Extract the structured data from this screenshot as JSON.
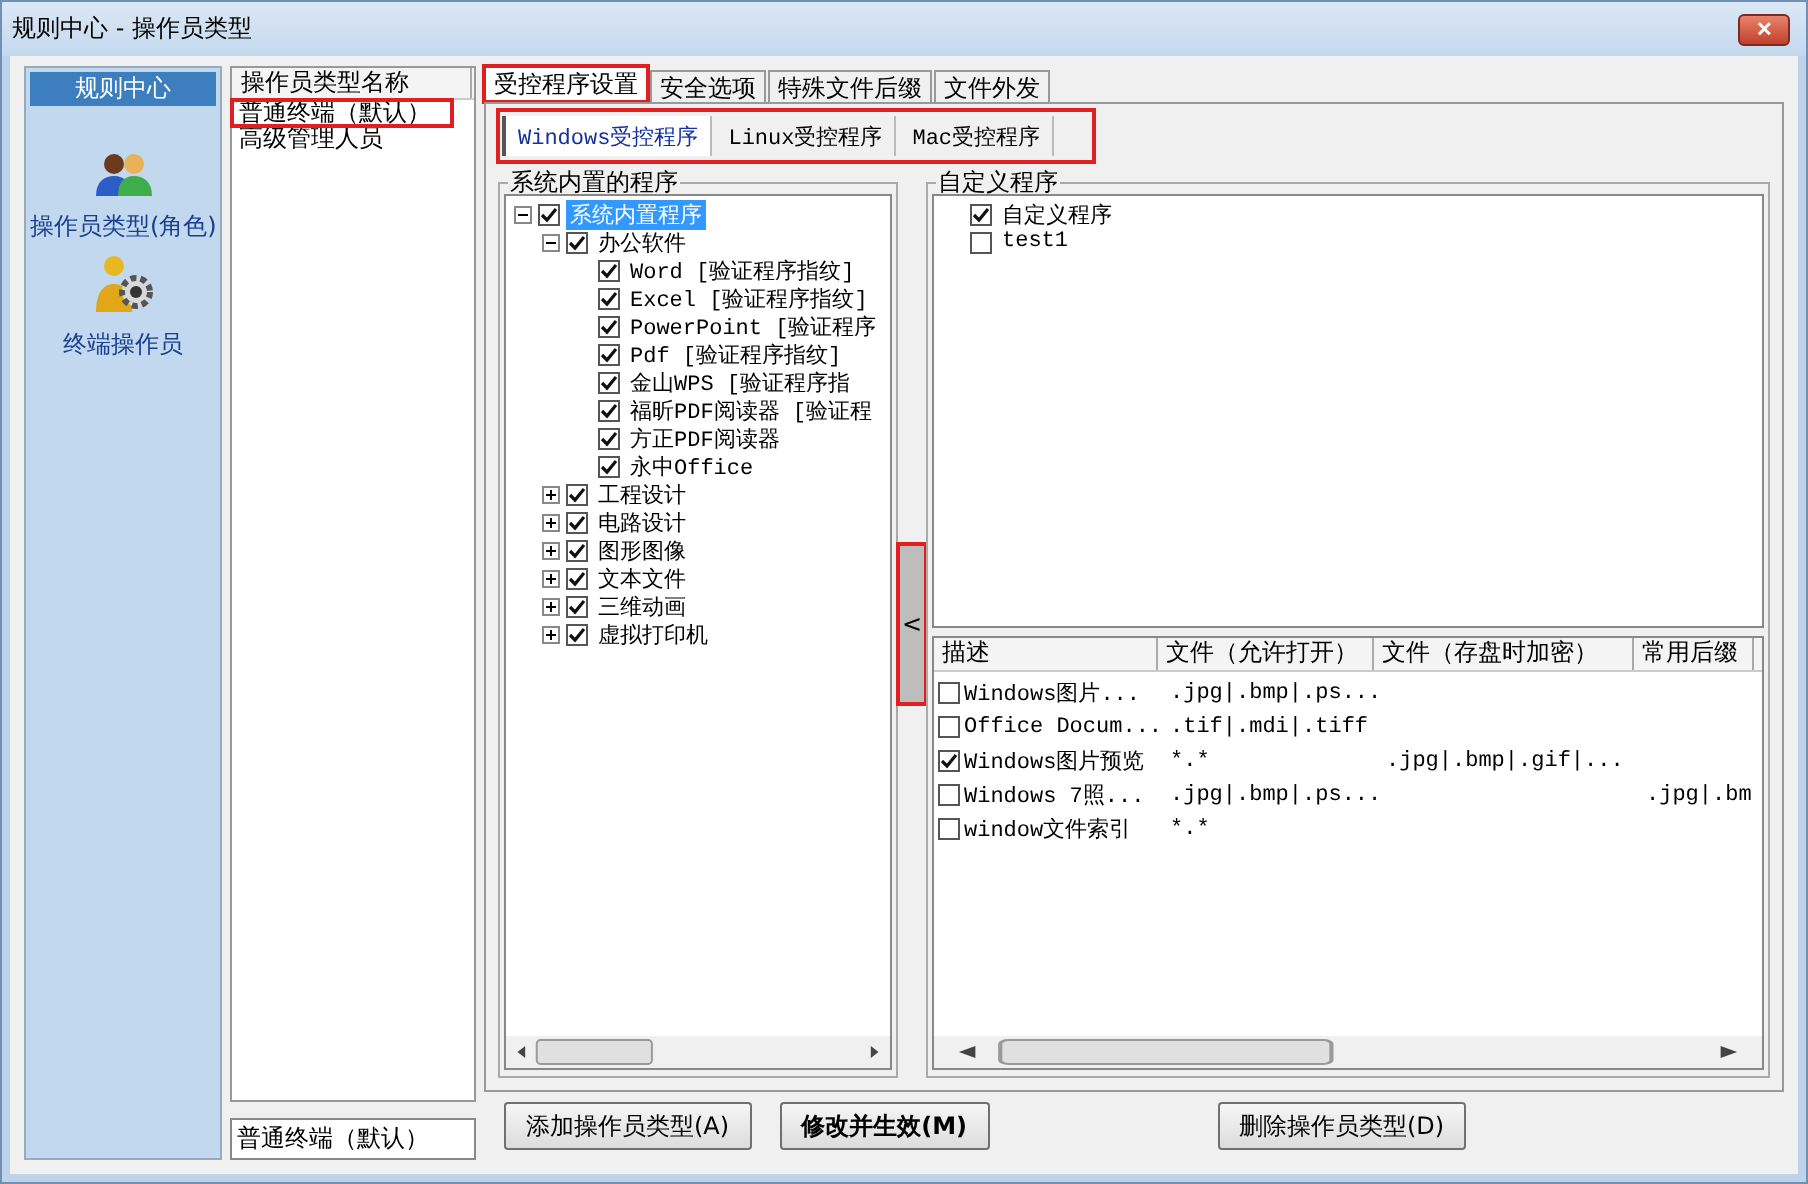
{
  "window": {
    "title": "规则中心 - 操作员类型",
    "close_glyph": "✕"
  },
  "sidebar": {
    "title": "规则中心",
    "items": [
      {
        "label": "操作员类型(角色)",
        "kind": "role"
      },
      {
        "label": "终端操作员",
        "kind": "terminal"
      }
    ]
  },
  "operator_types": {
    "columns": [
      "操作员类型名称"
    ],
    "rows": [
      {
        "label": "普通终端（默认）",
        "selected": false,
        "highlighted": true
      },
      {
        "label": "高级管理人员",
        "selected": false,
        "highlighted": false
      }
    ],
    "name_field": {
      "value": "普通终端（默认）"
    }
  },
  "tabs": [
    {
      "label": "受控程序设置",
      "selected": true,
      "highlighted": true
    },
    {
      "label": "安全选项",
      "selected": false,
      "highlighted": false
    },
    {
      "label": "特殊文件后缀",
      "selected": false,
      "highlighted": false
    },
    {
      "label": "文件外发",
      "selected": false,
      "highlighted": false
    }
  ],
  "subtab_bar": {
    "highlighted": true,
    "tabs": [
      {
        "label": "Windows受控程序",
        "selected": true
      },
      {
        "label": "Linux受控程序",
        "selected": false
      },
      {
        "label": "Mac受控程序",
        "selected": false
      }
    ]
  },
  "builtin_programs": {
    "title": "系统内置的程序",
    "tree": [
      {
        "label": "系统内置程序",
        "checked": true,
        "selected": true,
        "expanded": true,
        "children": [
          {
            "label": "办公软件",
            "checked": true,
            "selected": false,
            "expanded": true,
            "children": [
              {
                "label": "Word [验证程序指纹]",
                "checked": true,
                "selected": false
              },
              {
                "label": "Excel [验证程序指纹]",
                "checked": true,
                "selected": false
              },
              {
                "label": "PowerPoint [验证程序",
                "checked": true,
                "selected": false
              },
              {
                "label": "Pdf [验证程序指纹]",
                "checked": true,
                "selected": false
              },
              {
                "label": "金山WPS [验证程序指",
                "checked": true,
                "selected": false
              },
              {
                "label": "福昕PDF阅读器 [验证程",
                "checked": true,
                "selected": false
              },
              {
                "label": "方正PDF阅读器",
                "checked": true,
                "selected": false
              },
              {
                "label": "永中Office",
                "checked": true,
                "selected": false
              }
            ]
          },
          {
            "label": "工程设计",
            "checked": true,
            "selected": false,
            "expanded": false
          },
          {
            "label": "电路设计",
            "checked": true,
            "selected": false,
            "expanded": false
          },
          {
            "label": "图形图像",
            "checked": true,
            "selected": false,
            "expanded": false
          },
          {
            "label": "文本文件",
            "checked": true,
            "selected": false,
            "expanded": false
          },
          {
            "label": "三维动画",
            "checked": true,
            "selected": false,
            "expanded": false
          },
          {
            "label": "虚拟打印机",
            "checked": true,
            "selected": false,
            "expanded": false
          }
        ]
      }
    ]
  },
  "splitter": {
    "glyph": "<",
    "highlighted": true
  },
  "custom_programs": {
    "title": "自定义程序",
    "tree": [
      {
        "label": "自定义程序",
        "checked": true
      },
      {
        "label": "test1",
        "checked": false
      }
    ]
  },
  "file_rules": {
    "columns": [
      "描述",
      "文件（允许打开）",
      "文件（存盘时加密）",
      "常用后缀"
    ],
    "rows": [
      {
        "checked": false,
        "cells": [
          "Windows图片...",
          ".jpg|.bmp|.ps...",
          "",
          ""
        ]
      },
      {
        "checked": false,
        "cells": [
          "Office Docum...",
          ".tif|.mdi|.tiff",
          "",
          ""
        ]
      },
      {
        "checked": true,
        "cells": [
          "Windows图片预览",
          "*.*",
          ".jpg|.bmp|.gif|...",
          ""
        ]
      },
      {
        "checked": false,
        "cells": [
          "Windows 7照...",
          ".jpg|.bmp|.ps...",
          "",
          ".jpg|.bm"
        ]
      },
      {
        "checked": false,
        "cells": [
          "window文件索引",
          "*.*",
          "",
          ""
        ]
      }
    ]
  },
  "buttons": [
    {
      "label": "添加操作员类型(A)",
      "bold": false
    },
    {
      "label": "修改并生效(M)",
      "bold": true
    },
    {
      "label": "删除操作员类型(D)",
      "bold": false
    }
  ]
}
